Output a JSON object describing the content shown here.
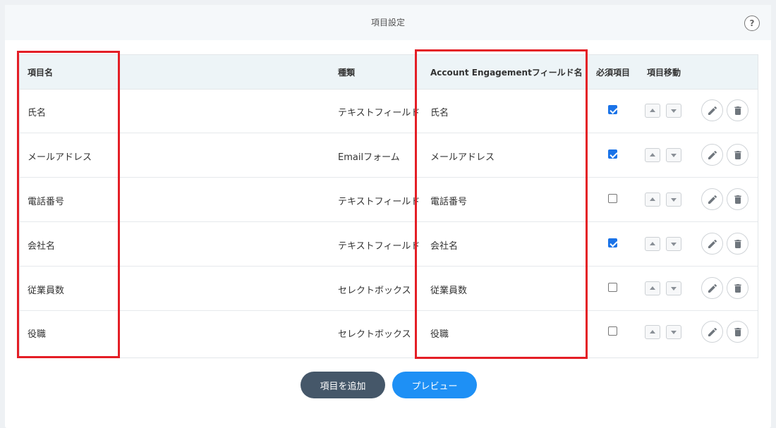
{
  "panel": {
    "title": "項目設定",
    "help_label": "?"
  },
  "table": {
    "headers": {
      "name": "項目名",
      "type": "種類",
      "ae_field": "Account Engagementフィールド名",
      "required": "必須項目",
      "move": "項目移動"
    },
    "rows": [
      {
        "name": "氏名",
        "type": "テキストフィールド",
        "ae_field": "氏名",
        "required": true
      },
      {
        "name": "メールアドレス",
        "type": "Emailフォーム",
        "ae_field": "メールアドレス",
        "required": true
      },
      {
        "name": "電話番号",
        "type": "テキストフィールド",
        "ae_field": "電話番号",
        "required": false
      },
      {
        "name": "会社名",
        "type": "テキストフィールド",
        "ae_field": "会社名",
        "required": true
      },
      {
        "name": "従業員数",
        "type": "セレクトボックス",
        "ae_field": "従業員数",
        "required": false
      },
      {
        "name": "役職",
        "type": "セレクトボックス",
        "ae_field": "役職",
        "required": false
      }
    ]
  },
  "actions": {
    "add_label": "項目を追加",
    "preview_label": "プレビュー"
  },
  "icons": {
    "help": "question-circle-icon",
    "move_up": "arrow-up-icon",
    "move_down": "arrow-down-icon",
    "edit": "pencil-icon",
    "delete": "trash-icon"
  },
  "colors": {
    "highlight": "#e41e26",
    "primary_button": "#1e90f5",
    "dark_button": "#455769",
    "checkbox_checked": "#1a73e8"
  }
}
